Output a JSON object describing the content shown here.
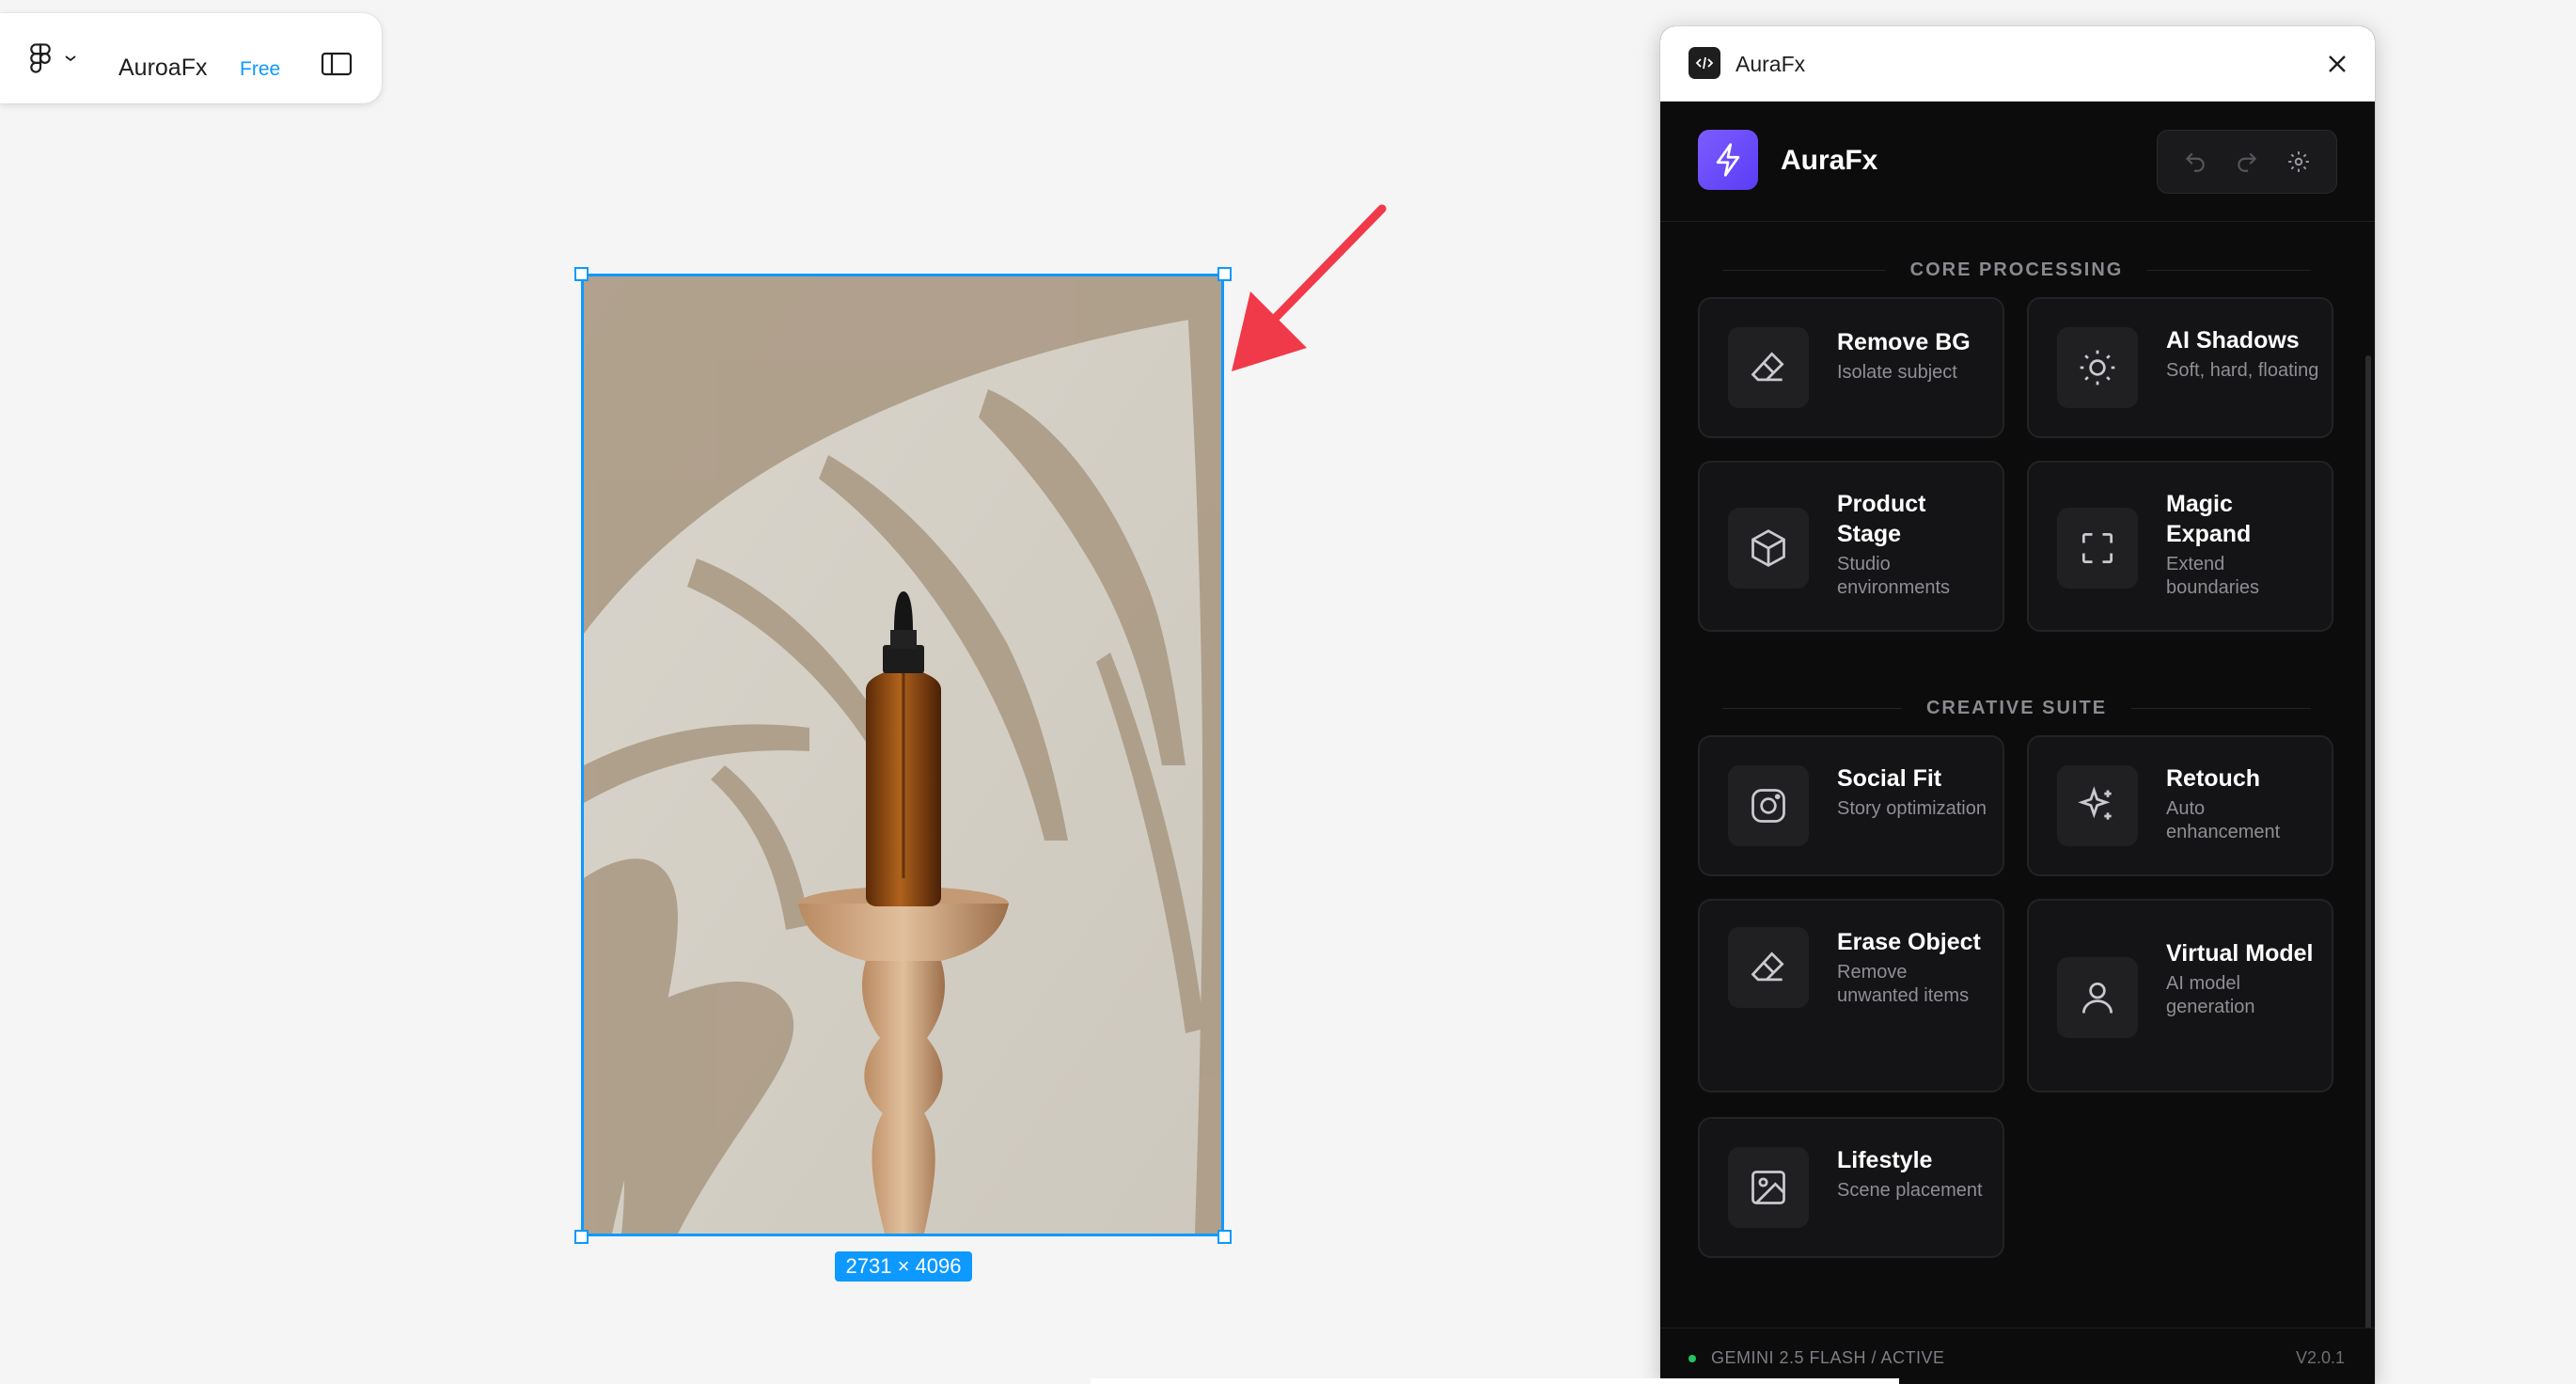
{
  "toolbar": {
    "app_name": "AuroaFx",
    "plan": "Free"
  },
  "canvas": {
    "dimensions_label": "2731 × 4096"
  },
  "plugin": {
    "window_title": "AuraFx",
    "brand_name": "AuraFx",
    "sections": [
      {
        "title": "CORE PROCESSING",
        "cards": [
          {
            "name": "Remove BG",
            "sub": "Isolate subject",
            "icon": "eraser-icon"
          },
          {
            "name": "AI Shadows",
            "sub": "Soft, hard, floating",
            "icon": "sun-icon"
          },
          {
            "name": "Product Stage",
            "sub": "Studio environments",
            "icon": "cube-icon"
          },
          {
            "name": "Magic Expand",
            "sub": "Extend boundaries",
            "icon": "expand-icon"
          }
        ]
      },
      {
        "title": "CREATIVE SUITE",
        "cards": [
          {
            "name": "Social Fit",
            "sub": "Story optimization",
            "icon": "instagram-icon"
          },
          {
            "name": "Retouch",
            "sub": "Auto enhancement",
            "icon": "sparkles-icon"
          },
          {
            "name": "Erase Object",
            "sub": "Remove unwanted items",
            "icon": "eraser-icon"
          },
          {
            "name": "Virtual Model",
            "sub": "AI model generation",
            "icon": "user-icon"
          },
          {
            "name": "Lifestyle",
            "sub": "Scene placement",
            "icon": "image-icon"
          }
        ]
      }
    ],
    "footer": {
      "status": "GEMINI 2.5 FLASH / ACTIVE",
      "version": "V2.0.1"
    }
  },
  "colors": {
    "accent": "#0d99ff",
    "brand": "#6c4cff",
    "plugin_bg": "#0c0c0d",
    "status_active": "#22c55e",
    "arrow": "#f03a4a"
  }
}
